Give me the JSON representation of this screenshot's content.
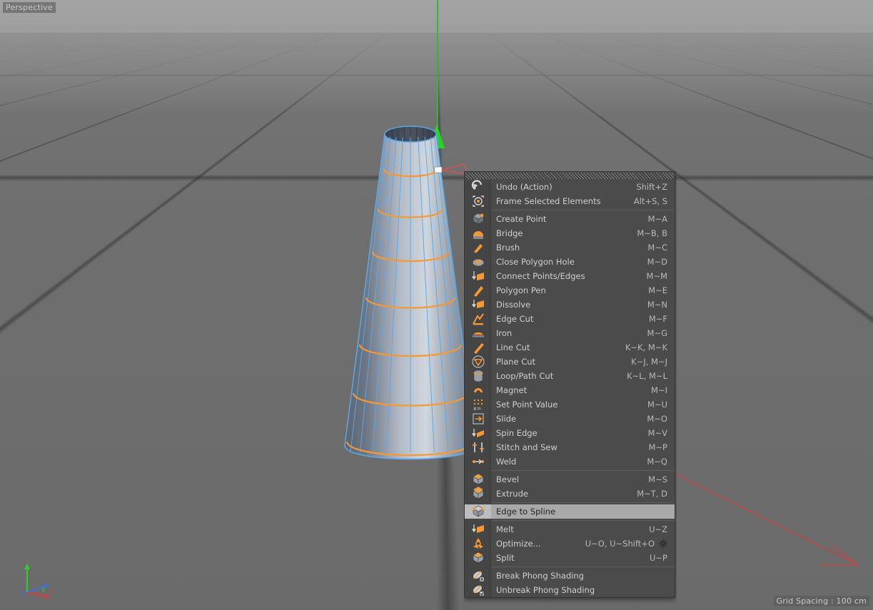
{
  "viewport": {
    "perspective_label": "Perspective",
    "grid_spacing_label": "Grid Spacing : 100 cm",
    "axis_x_label": "X",
    "axis_y_label": "Y",
    "axis_z_label": "Z",
    "colors": {
      "background": "#6e6e6e",
      "sky": "#a0a0a0",
      "grid_line": "#3d3d3d",
      "axis_x": "#d84b4b",
      "axis_y": "#2fcc2f",
      "axis_z": "#3f6fd8",
      "selected_edge": "#f79833",
      "wireframe_edge": "#57a8e8",
      "object_fill": "#9aa2ad"
    },
    "object": {
      "name": "cone-frustum",
      "selected_edge_loops": 7,
      "wireframe_segments": 24
    }
  },
  "context_menu": {
    "name": "mesh-commands-menu",
    "gripper": true,
    "groups": [
      {
        "name": "history-group",
        "items": [
          {
            "label": "Undo (Action)",
            "shortcut": "Shift+Z",
            "icon": "undo-icon"
          },
          {
            "label": "Frame Selected Elements",
            "shortcut": "Alt+S, S",
            "icon": "frame-selected-icon"
          }
        ]
      },
      {
        "name": "modeling-group",
        "items": [
          {
            "label": "Create Point",
            "shortcut": "M~A",
            "icon": "create-point-icon"
          },
          {
            "label": "Bridge",
            "shortcut": "M~B, B",
            "icon": "bridge-icon"
          },
          {
            "label": "Brush",
            "shortcut": "M~C",
            "icon": "brush-icon"
          },
          {
            "label": "Close Polygon Hole",
            "shortcut": "M~D",
            "icon": "close-polygon-hole-icon"
          },
          {
            "label": "Connect Points/Edges",
            "shortcut": "M~M",
            "icon": "connect-points-edges-icon"
          },
          {
            "label": "Polygon Pen",
            "shortcut": "M~E",
            "icon": "polygon-pen-icon"
          },
          {
            "label": "Dissolve",
            "shortcut": "M~N",
            "icon": "dissolve-icon"
          },
          {
            "label": "Edge Cut",
            "shortcut": "M~F",
            "icon": "edge-cut-icon"
          },
          {
            "label": "Iron",
            "shortcut": "M~G",
            "icon": "iron-icon"
          },
          {
            "label": "Line Cut",
            "shortcut": "K~K, M~K",
            "icon": "line-cut-icon"
          },
          {
            "label": "Plane Cut",
            "shortcut": "K~J, M~J",
            "icon": "plane-cut-icon"
          },
          {
            "label": "Loop/Path Cut",
            "shortcut": "K~L, M~L",
            "icon": "loop-path-cut-icon"
          },
          {
            "label": "Magnet",
            "shortcut": "M~I",
            "icon": "magnet-icon"
          },
          {
            "label": "Set Point Value",
            "shortcut": "M~U",
            "icon": "set-point-value-icon"
          },
          {
            "label": "Slide",
            "shortcut": "M~O",
            "icon": "slide-icon"
          },
          {
            "label": "Spin Edge",
            "shortcut": "M~V",
            "icon": "spin-edge-icon"
          },
          {
            "label": "Stitch and Sew",
            "shortcut": "M~P",
            "icon": "stitch-and-sew-icon"
          },
          {
            "label": "Weld",
            "shortcut": "M~Q",
            "icon": "weld-icon"
          }
        ]
      },
      {
        "name": "bevel-extrude-group",
        "items": [
          {
            "label": "Bevel",
            "shortcut": "M~S",
            "icon": "bevel-icon"
          },
          {
            "label": "Extrude",
            "shortcut": "M~T, D",
            "icon": "extrude-icon"
          }
        ]
      },
      {
        "name": "edge-to-spline-group",
        "items": [
          {
            "label": "Edge to Spline",
            "shortcut": "",
            "icon": "edge-to-spline-icon",
            "selected": true
          }
        ]
      },
      {
        "name": "cleanup-group",
        "items": [
          {
            "label": "Melt",
            "shortcut": "U~Z",
            "icon": "melt-icon"
          },
          {
            "label": "Optimize...",
            "shortcut": "U~O, U~Shift+O",
            "icon": "optimize-icon",
            "gear": true
          },
          {
            "label": "Split",
            "shortcut": "U~P",
            "icon": "split-icon"
          }
        ]
      },
      {
        "name": "phong-group",
        "items": [
          {
            "label": "Break Phong Shading",
            "shortcut": "",
            "icon": "break-phong-icon"
          },
          {
            "label": "Unbreak Phong Shading",
            "shortcut": "",
            "icon": "unbreak-phong-icon"
          }
        ]
      }
    ]
  }
}
